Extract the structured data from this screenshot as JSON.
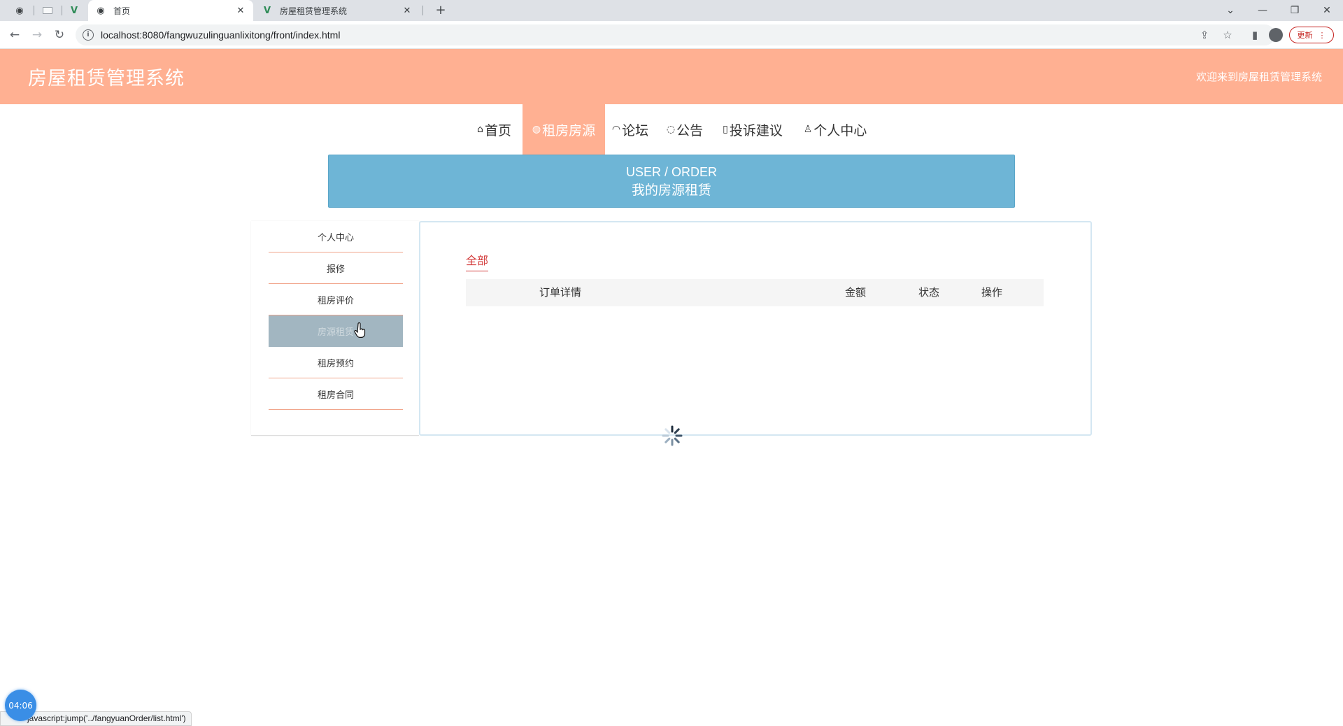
{
  "browser": {
    "tabs": [
      {
        "title": "首页",
        "active": true
      },
      {
        "title": "房屋租赁管理系统",
        "active": false
      }
    ],
    "new_tab_label": "+",
    "url": "localhost:8080/fangwuzulinguanlixitong/front/index.html",
    "update_label": "更新",
    "status_text": "javascript:jump('../fangyuanOrder/list.html')",
    "timer": "04:06"
  },
  "header": {
    "title": "房屋租赁管理系统",
    "welcome": "欢迎来到房屋租赁管理系统"
  },
  "nav": {
    "items": [
      {
        "label": "首页",
        "icon": "home-icon",
        "glyph": "⌂"
      },
      {
        "label": "租房房源",
        "icon": "globe-icon",
        "glyph": "◍"
      },
      {
        "label": "论坛",
        "icon": "dashboard-icon",
        "glyph": "◠"
      },
      {
        "label": "公告",
        "icon": "palette-icon",
        "glyph": "◌"
      },
      {
        "label": "投诉建议",
        "icon": "file-icon",
        "glyph": "▯"
      },
      {
        "label": "个人中心",
        "icon": "user-icon",
        "glyph": "♙"
      }
    ],
    "active_index": 1
  },
  "banner": {
    "en": "USER / ORDER",
    "cn": "我的房源租赁"
  },
  "sidebar": {
    "items": [
      {
        "label": "个人中心"
      },
      {
        "label": "报修"
      },
      {
        "label": "租房评价"
      },
      {
        "label": "房源租赁"
      },
      {
        "label": "租房预约"
      },
      {
        "label": "租房合同"
      }
    ],
    "active_index": 3
  },
  "content": {
    "filter_tab": "全部",
    "columns": [
      "订单详情",
      "金额",
      "状态",
      "操作"
    ]
  },
  "colors": {
    "primary": "#ffb092",
    "banner": "#6eb5d6",
    "sidebar_active": "#a2b6c1",
    "filter_active": "#d33b3b"
  }
}
